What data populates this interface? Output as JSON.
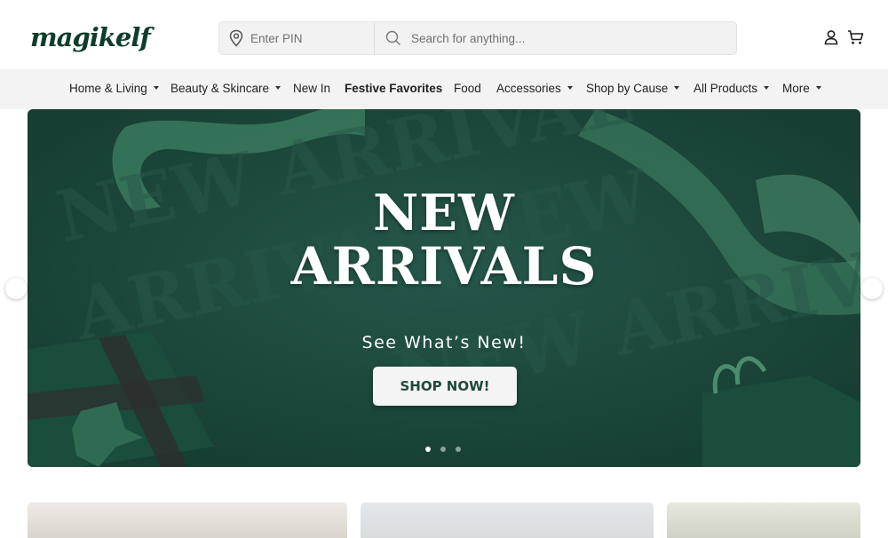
{
  "header": {
    "logo_text": "magikelf",
    "logo_mark": "®",
    "pin_placeholder": "Enter PIN",
    "search_placeholder": "Search for anything...",
    "icons": [
      "location-pin-icon",
      "search-icon",
      "user-icon",
      "cart-icon"
    ]
  },
  "nav": {
    "items": [
      {
        "label": "Home & Living",
        "dropdown": true
      },
      {
        "label": "Beauty & Skincare",
        "dropdown": true
      },
      {
        "label": "New In",
        "dropdown": false
      },
      {
        "label": "Festive Favorites",
        "dropdown": false,
        "bold": true
      },
      {
        "label": "Food",
        "dropdown": false
      },
      {
        "label": "Accessories",
        "dropdown": true
      },
      {
        "label": "Shop by Cause",
        "dropdown": true
      },
      {
        "label": "All Products",
        "dropdown": true
      },
      {
        "label": "More",
        "dropdown": true
      }
    ]
  },
  "hero": {
    "title_line1": "NEW",
    "title_line2": "ARRIVALS",
    "subtitle": "See What’s New!",
    "cta_label": "SHOP NOW!",
    "background_color": "#1f4a3b",
    "slides_count": 3,
    "active_slide": 1
  },
  "colors": {
    "brand_green": "#0f3d2b",
    "nav_background": "#f3f3f3",
    "search_background": "#f2f2f2"
  }
}
